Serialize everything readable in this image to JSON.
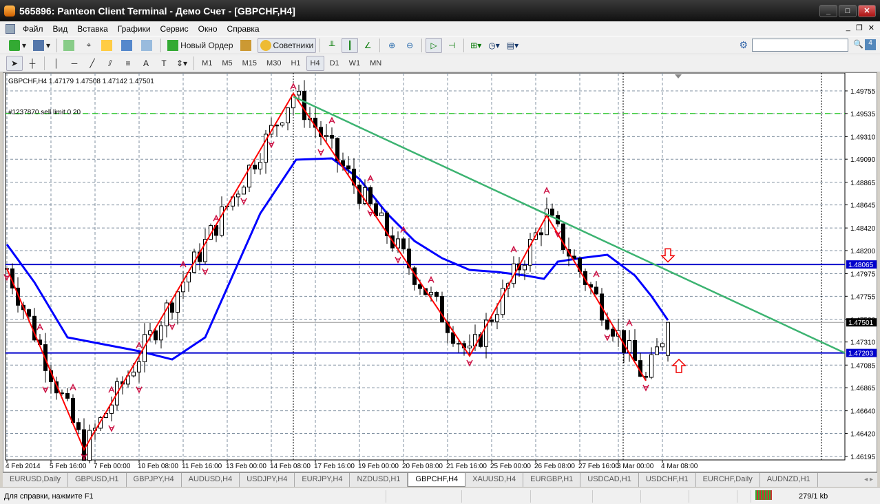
{
  "window": {
    "title": "565896: Panteon Client Terminal - Демо Счет - [GBPCHF,H4]"
  },
  "menu": [
    "Файл",
    "Вид",
    "Вставка",
    "Графики",
    "Сервис",
    "Окно",
    "Справка"
  ],
  "toolbar": {
    "new_order": "Новый Ордер",
    "experts": "Советники",
    "search_placeholder": ""
  },
  "timeframes": [
    "M1",
    "M5",
    "M15",
    "M30",
    "H1",
    "H4",
    "D1",
    "W1",
    "MN"
  ],
  "active_timeframe": "H4",
  "chart": {
    "header": "GBPCHF,H4  1.47179 1.47508 1.47142 1.47501",
    "order_label": "#1237870 sell limit 0.20",
    "colors": {
      "zigzag": "#ff0000",
      "ma": "#0000ff",
      "trend": "#3cb371",
      "hline": "#0000cc",
      "order": "#33cc33",
      "fractal": "#cc1144"
    }
  },
  "chart_data": {
    "type": "candlestick",
    "symbol": "GBPCHF",
    "timeframe": "H4",
    "ohlc_last": {
      "open": 1.47179,
      "high": 1.47508,
      "low": 1.47142,
      "close": 1.47501
    },
    "price_ticks": [
      "1.49755",
      "1.49535",
      "1.49310",
      "1.49090",
      "1.48865",
      "1.48645",
      "1.48420",
      "1.48200",
      "1.47975",
      "1.47755",
      "1.47530",
      "1.47310",
      "1.47085",
      "1.46865",
      "1.46640",
      "1.46420",
      "1.46195"
    ],
    "price_range": [
      1.46195,
      1.49755
    ],
    "time_labels": [
      {
        "bar": 0,
        "label": "4 Feb 2014"
      },
      {
        "bar": 8,
        "label": "5 Feb 16:00"
      },
      {
        "bar": 16,
        "label": "7 Feb 00:00"
      },
      {
        "bar": 24,
        "label": "10 Feb 08:00"
      },
      {
        "bar": 32,
        "label": "11 Feb 16:00"
      },
      {
        "bar": 40,
        "label": "13 Feb 00:00"
      },
      {
        "bar": 48,
        "label": "14 Feb 08:00"
      },
      {
        "bar": 56,
        "label": "17 Feb 16:00"
      },
      {
        "bar": 64,
        "label": "19 Feb 00:00"
      },
      {
        "bar": 72,
        "label": "20 Feb 08:00"
      },
      {
        "bar": 80,
        "label": "21 Feb 16:00"
      },
      {
        "bar": 88,
        "label": "25 Feb 00:00"
      },
      {
        "bar": 96,
        "label": "26 Feb 08:00"
      },
      {
        "bar": 104,
        "label": "27 Feb 16:00"
      },
      {
        "bar": 111,
        "label": "3 Mar 00:00"
      },
      {
        "bar": 119,
        "label": "4 Mar 08:00"
      }
    ],
    "bar_count": 121,
    "zigzag": [
      [
        0,
        1.48025
      ],
      [
        14,
        1.46262
      ],
      [
        52,
        1.4973
      ],
      [
        84,
        1.47174
      ],
      [
        98,
        1.48542
      ],
      [
        116,
        1.46933
      ],
      [
        120,
        1.47501
      ]
    ],
    "moving_average": [
      [
        0,
        1.4826
      ],
      [
        5,
        1.47891
      ],
      [
        11,
        1.47355
      ],
      [
        17.5,
        1.47288
      ],
      [
        24,
        1.47221
      ],
      [
        30,
        1.4714
      ],
      [
        36,
        1.47355
      ],
      [
        41,
        1.47958
      ],
      [
        46,
        1.48562
      ],
      [
        52.5,
        1.49085
      ],
      [
        59,
        1.49098
      ],
      [
        64,
        1.48897
      ],
      [
        69,
        1.48562
      ],
      [
        74,
        1.48293
      ],
      [
        79,
        1.48126
      ],
      [
        84,
        1.48012
      ],
      [
        89,
        1.47992
      ],
      [
        94,
        1.47958
      ],
      [
        97.5,
        1.47925
      ],
      [
        100,
        1.48092
      ],
      [
        104,
        1.48126
      ],
      [
        109,
        1.48159
      ],
      [
        114,
        1.47958
      ],
      [
        117,
        1.47757
      ],
      [
        120,
        1.47522
      ]
    ],
    "trendline": [
      [
        52,
        1.497
      ],
      [
        151,
        1.47203
      ]
    ],
    "hlines": [
      {
        "price": 1.48065,
        "label": "1.48065"
      },
      {
        "price": 1.47203,
        "label": "1.47203"
      }
    ],
    "order_line": {
      "price": 1.49535,
      "label": "1.49535"
    },
    "current_price": {
      "price": 1.47501,
      "label": "1.47501"
    },
    "fractals_up": [
      6,
      12,
      19,
      24,
      32,
      38,
      52,
      59,
      66,
      72,
      77,
      92,
      98,
      107,
      113
    ],
    "fractals_down": [
      0,
      7,
      14,
      19,
      24,
      30,
      36,
      43,
      48,
      57,
      66,
      71,
      84,
      100,
      109,
      116
    ],
    "arrows": [
      {
        "bar": 120,
        "price": 1.4815,
        "dir": "down"
      },
      {
        "bar": 122,
        "price": 1.4708,
        "dir": "up"
      }
    ]
  },
  "tabs": [
    "EURUSD,Daily",
    "GBPUSD,H1",
    "GBPJPY,H4",
    "AUDUSD,H4",
    "USDJPY,H4",
    "EURJPY,H4",
    "NZDUSD,H1",
    "GBPCHF,H4",
    "XAUUSD,H4",
    "EURGBP,H1",
    "USDCAD,H1",
    "USDCHF,H1",
    "EURCHF,Daily",
    "AUDNZD,H1"
  ],
  "active_tab": "GBPCHF,H4",
  "status": {
    "help": "Для справки, нажмите F1",
    "traffic": "279/1 kb"
  }
}
